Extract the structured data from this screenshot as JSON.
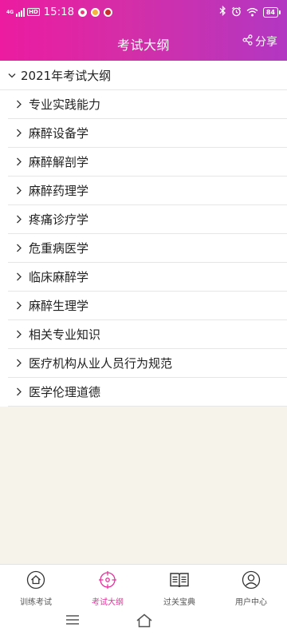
{
  "status": {
    "network": "4G",
    "hd": "HD",
    "time": "15:18",
    "battery": "84"
  },
  "header": {
    "title": "考试大纲",
    "share_label": "分享"
  },
  "outline": {
    "year_title": "2021年考试大纲",
    "items": [
      "专业实践能力",
      "麻醉设备学",
      "麻醉解剖学",
      "麻醉药理学",
      "疼痛诊疗学",
      "危重病医学",
      "临床麻醉学",
      "麻醉生理学",
      "相关专业知识",
      "医疗机构从业人员行为规范",
      "医学伦理道德"
    ]
  },
  "tabs": [
    {
      "label": "训练考试",
      "icon": "home-icon",
      "active": false
    },
    {
      "label": "考试大纲",
      "icon": "target-icon",
      "active": true
    },
    {
      "label": "过关宝典",
      "icon": "book-icon",
      "active": false
    },
    {
      "label": "用户中心",
      "icon": "user-icon",
      "active": false
    }
  ],
  "colors": {
    "header_start": "#ec1ba0",
    "header_end": "#b237c2",
    "accent": "#e8319e",
    "background": "#f6f3ea"
  }
}
